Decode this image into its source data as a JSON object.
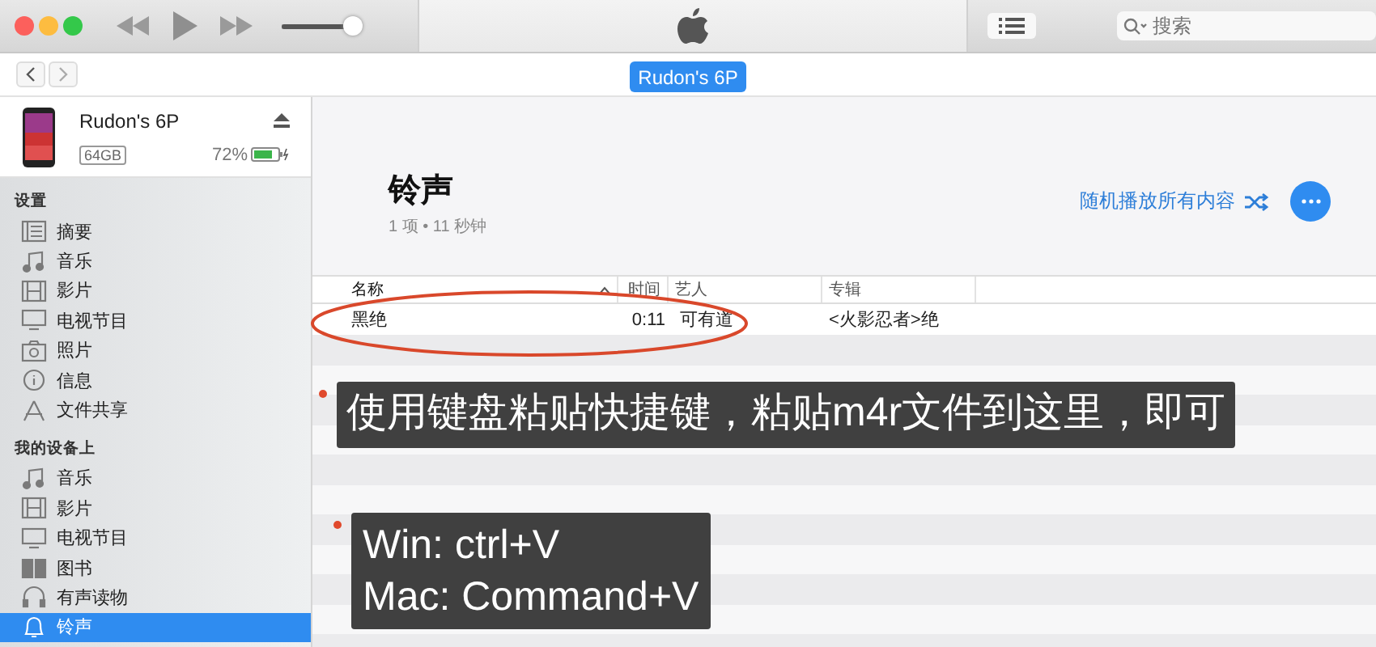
{
  "toolbar": {
    "volume": {
      "level": 0.95
    },
    "search": {
      "placeholder": "搜索"
    }
  },
  "nav": {
    "device_tab": "Rudon's 6P"
  },
  "device": {
    "name": "Rudon's 6P",
    "capacity": "64GB",
    "battery_text": "72%",
    "charging": true
  },
  "sidebar": {
    "sections": [
      {
        "title": "设置",
        "items": [
          {
            "kind": "summary",
            "label": "摘要",
            "selected": false
          },
          {
            "kind": "music",
            "label": "音乐",
            "selected": false
          },
          {
            "kind": "film",
            "label": "影片",
            "selected": false
          },
          {
            "kind": "tv",
            "label": "电视节目",
            "selected": false
          },
          {
            "kind": "photo",
            "label": "照片",
            "selected": false
          },
          {
            "kind": "info",
            "label": "信息",
            "selected": false
          },
          {
            "kind": "apps",
            "label": "文件共享",
            "selected": false
          }
        ]
      },
      {
        "title": "我的设备上",
        "items": [
          {
            "kind": "music",
            "label": "音乐",
            "selected": false
          },
          {
            "kind": "film",
            "label": "影片",
            "selected": false
          },
          {
            "kind": "tv",
            "label": "电视节目",
            "selected": false
          },
          {
            "kind": "book",
            "label": "图书",
            "selected": false
          },
          {
            "kind": "headphones",
            "label": "有声读物",
            "selected": false
          },
          {
            "kind": "bell",
            "label": "铃声",
            "selected": true
          }
        ]
      }
    ]
  },
  "content": {
    "title": "铃声",
    "subtitle": "1 项 • 11 秒钟",
    "shuffle": "随机播放所有内容",
    "table": {
      "columns": [
        {
          "label": "名称",
          "sorted": true
        },
        {
          "label": "时间",
          "sorted": false
        },
        {
          "label": "艺人",
          "sorted": false
        },
        {
          "label": "专辑",
          "sorted": false
        }
      ],
      "rows": [
        {
          "cells": [
            "黑绝",
            "0:11",
            "可有道",
            "<火影忍者>绝"
          ]
        }
      ]
    }
  },
  "annotations": [
    {
      "lines": [
        "使用键盘粘贴快捷键，粘贴m4r文件到这里，即可"
      ]
    },
    {
      "lines": [
        "Win: ctrl+V",
        "Mac: Command+V"
      ]
    }
  ]
}
